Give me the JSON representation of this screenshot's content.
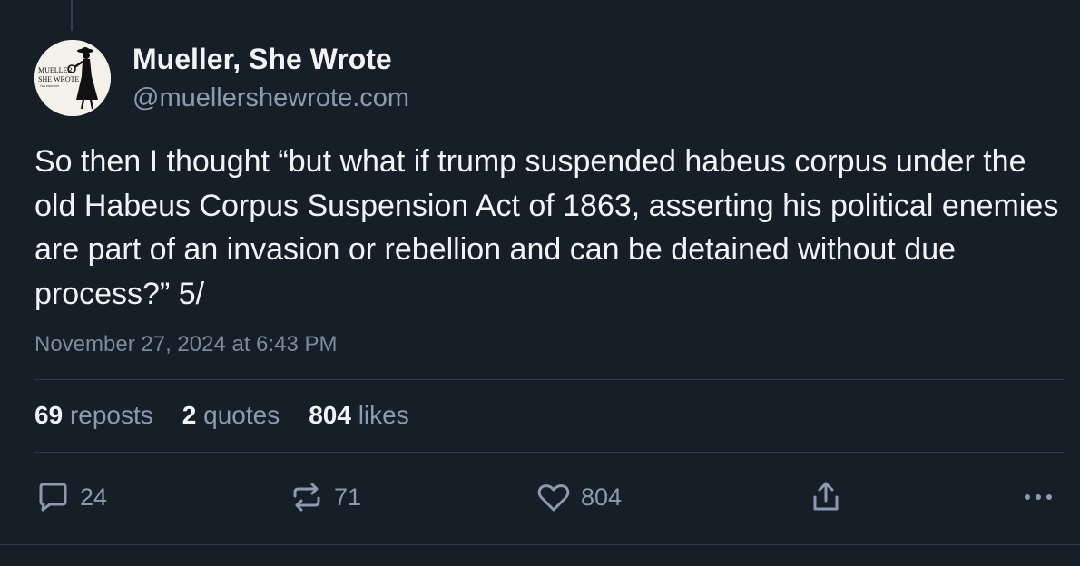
{
  "post": {
    "author": {
      "display_name": "Mueller, She Wrote",
      "handle": "@muellershewrote.com",
      "avatar_text_line1": "MUELLER,",
      "avatar_text_line2": "SHE WROTE",
      "avatar_text_line3": "THE PODCAST"
    },
    "text": "So then I thought “but what if trump suspended habeus corpus under the old Habeus Corpus Suspension Act of 1863, asserting his political enemies are part of an invasion or rebellion and can be detained without due process?” 5/",
    "timestamp": "November 27, 2024 at 6:43 PM"
  },
  "stats": {
    "reposts_count": "69",
    "reposts_label": "reposts",
    "quotes_count": "2",
    "quotes_label": "quotes",
    "likes_count": "804",
    "likes_label": "likes"
  },
  "actions": {
    "reply_count": "24",
    "repost_count": "71",
    "like_count": "804"
  },
  "icons": {
    "reply": "speech-bubble-icon",
    "repost": "repost-arrows-icon",
    "like": "heart-icon",
    "share": "share-upload-icon",
    "more": "ellipsis-icon"
  },
  "colors": {
    "background": "#161e27",
    "text_primary": "#f1f3f5",
    "text_secondary": "#8a9bb0",
    "divider": "#2c3a49"
  }
}
